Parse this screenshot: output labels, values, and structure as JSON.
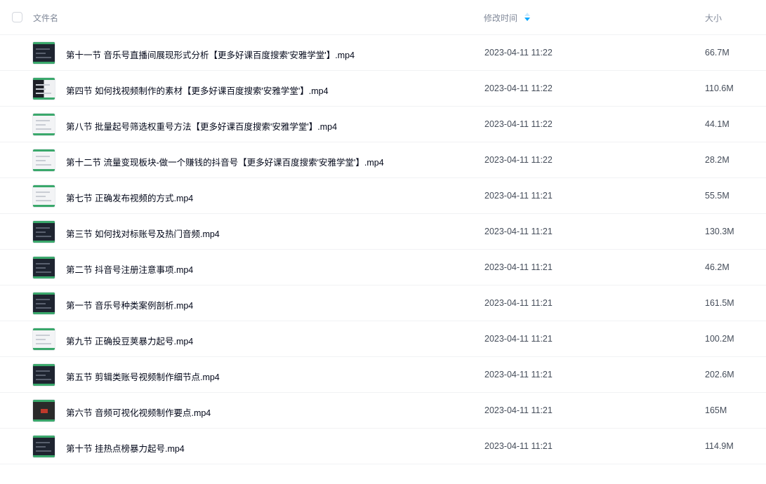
{
  "header": {
    "name_label": "文件名",
    "time_label": "修改时间",
    "size_label": "大小"
  },
  "accent_color": "#06a7ff",
  "files": [
    {
      "name": "第十一节 音乐号直播间展现形式分析【更多好课百度搜索'安雅学堂'】.mp4",
      "time": "2023-04-11 11:22",
      "size": "66.7M",
      "thumb": "dark"
    },
    {
      "name": "第四节 如何找视频制作的素材【更多好课百度搜索'安雅学堂'】.mp4",
      "time": "2023-04-11 11:22",
      "size": "110.6M",
      "thumb": "mix"
    },
    {
      "name": "第八节 批量起号筛选权重号方法【更多好课百度搜索'安雅学堂'】.mp4",
      "time": "2023-04-11 11:22",
      "size": "44.1M",
      "thumb": "light"
    },
    {
      "name": "第十二节 流量变现板块-做一个赚钱的抖音号【更多好课百度搜索'安雅学堂'】.mp4",
      "time": "2023-04-11 11:22",
      "size": "28.2M",
      "thumb": "light"
    },
    {
      "name": "第七节 正确发布视频的方式.mp4",
      "time": "2023-04-11 11:21",
      "size": "55.5M",
      "thumb": "light"
    },
    {
      "name": "第三节 如何找对标账号及热门音频.mp4",
      "time": "2023-04-11 11:21",
      "size": "130.3M",
      "thumb": "dark"
    },
    {
      "name": "第二节 抖音号注册注意事项.mp4",
      "time": "2023-04-11 11:21",
      "size": "46.2M",
      "thumb": "dark"
    },
    {
      "name": "第一节 音乐号种类案例剖析.mp4",
      "time": "2023-04-11 11:21",
      "size": "161.5M",
      "thumb": "dark"
    },
    {
      "name": "第九节 正确投豆荚暴力起号.mp4",
      "time": "2023-04-11 11:21",
      "size": "100.2M",
      "thumb": "light"
    },
    {
      "name": "第五节 剪辑类账号视频制作细节点.mp4",
      "time": "2023-04-11 11:21",
      "size": "202.6M",
      "thumb": "dark"
    },
    {
      "name": "第六节 音频可视化视频制作要点.mp4",
      "time": "2023-04-11 11:21",
      "size": "165M",
      "thumb": "vid"
    },
    {
      "name": "第十节 挂热点榜暴力起号.mp4",
      "time": "2023-04-11 11:21",
      "size": "114.9M",
      "thumb": "dark"
    }
  ]
}
